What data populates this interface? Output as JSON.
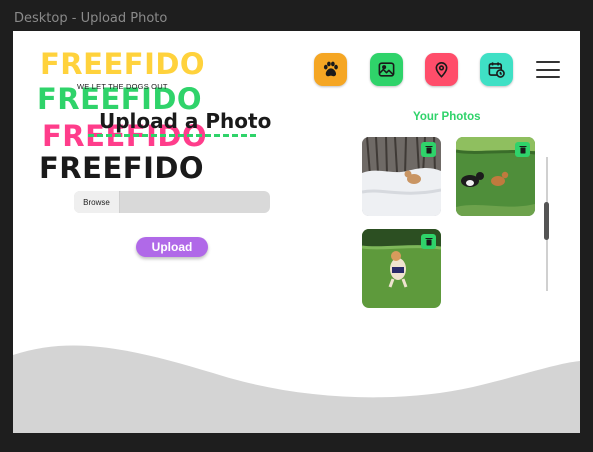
{
  "frame": {
    "label": "Desktop - Upload Photo"
  },
  "logo": {
    "word": "FREEFIDO",
    "tagline": "WE LET THE DOGS OUT"
  },
  "nav": {
    "items": [
      {
        "name": "paw-icon",
        "color": "#f5a623"
      },
      {
        "name": "gallery-icon",
        "color": "#2fd36a"
      },
      {
        "name": "location-pin-icon",
        "color": "#ff4d6a"
      },
      {
        "name": "calendar-clock-icon",
        "color": "#3fe0c5"
      }
    ],
    "menu_icon": "hamburger-icon"
  },
  "upload": {
    "title": "Upload a Photo",
    "browse_label": "Browse",
    "file_value": "",
    "button_label": "Upload"
  },
  "photos": {
    "title": "Your Photos",
    "items": [
      {
        "description_icon": "dog-in-snow-photo",
        "delete_icon": "trash-icon"
      },
      {
        "description_icon": "two-dogs-running-photo",
        "delete_icon": "trash-icon"
      },
      {
        "description_icon": "dog-on-grass-photo",
        "delete_icon": "trash-icon"
      }
    ]
  },
  "colors": {
    "accent_green": "#2fd36a",
    "upload_purple": "#b069e8",
    "wave_gray": "#d4d4d4"
  }
}
